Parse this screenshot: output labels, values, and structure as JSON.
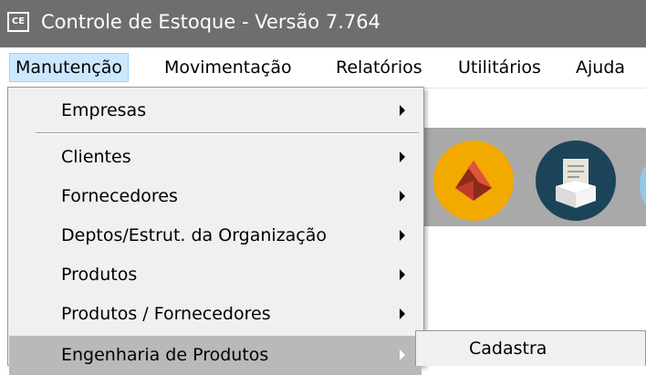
{
  "window": {
    "icon_text": "CE",
    "title": "Controle de Estoque - Versão 7.764"
  },
  "menubar": {
    "items": [
      {
        "label": "Manutenção",
        "active": true
      },
      {
        "label": "Movimentação"
      },
      {
        "label": "Relatórios"
      },
      {
        "label": "Utilitários"
      },
      {
        "label": "Ajuda"
      }
    ]
  },
  "dropdown": {
    "items": [
      {
        "label": "Empresas",
        "has_submenu": true
      },
      {
        "label": "Clientes",
        "has_submenu": true
      },
      {
        "label": "Fornecedores",
        "has_submenu": true
      },
      {
        "label": "Deptos/Estrut. da Organização",
        "has_submenu": true
      },
      {
        "label": "Produtos",
        "has_submenu": true
      },
      {
        "label": "Produtos / Fornecedores",
        "has_submenu": true
      },
      {
        "label": "Engenharia de Produtos",
        "has_submenu": true,
        "highlighted": true
      }
    ]
  },
  "submenu": {
    "items": [
      {
        "label": "Cadastra"
      }
    ]
  },
  "toolbar": {
    "buttons": [
      {
        "icon": "shipping-icon",
        "color": "#f2a900"
      },
      {
        "icon": "package-document-icon",
        "color": "#1c4459"
      },
      {
        "icon": "partial-icon",
        "color": "#8fc9e6"
      }
    ]
  },
  "colors": {
    "titlebar": "#6e6e6e",
    "menu_bg": "#f0f0f0",
    "highlight": "#b9b9b9",
    "toolbar_bg": "#a9a9a9"
  }
}
